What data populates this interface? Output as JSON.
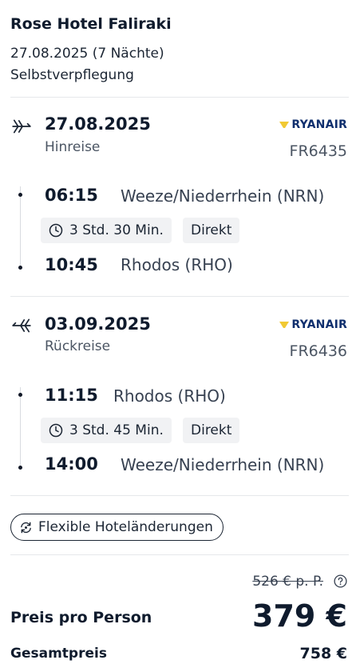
{
  "hotel": {
    "name": "Rose Hotel Faliraki",
    "dates": "27.08.2025 (7 Nächte)",
    "board": "Selbstverpflegung"
  },
  "outbound": {
    "date": "27.08.2025",
    "label": "Hinreise",
    "airline": "RYANAIR",
    "flight_number": "FR6435",
    "departure_time": "06:15",
    "departure_airport": "Weeze/Niederrhein (NRN)",
    "duration": "3 Std. 30 Min.",
    "stops": "Direkt",
    "arrival_time": "10:45",
    "arrival_airport": "Rhodos (RHO)"
  },
  "return": {
    "date": "03.09.2025",
    "label": "Rückreise",
    "airline": "RYANAIR",
    "flight_number": "FR6436",
    "departure_time": "11:15",
    "departure_airport": "Rhodos (RHO)",
    "duration": "3 Std. 45 Min.",
    "stops": "Direkt",
    "arrival_time": "14:00",
    "arrival_airport": "Weeze/Niederrhein (NRN)"
  },
  "flex_badge": "Flexible Hoteländerungen",
  "price": {
    "old": "526 € p. P.",
    "per_person_label": "Preis pro Person",
    "per_person": "379 €",
    "total_label": "Gesamtpreis",
    "total": "758 €"
  },
  "colors": {
    "text": "#0f1b2d",
    "secondary": "#4b5563",
    "ryanair_blue": "#0f2f6e",
    "ryanair_gold": "#f1c933",
    "chip_bg": "#f1f2f4"
  }
}
